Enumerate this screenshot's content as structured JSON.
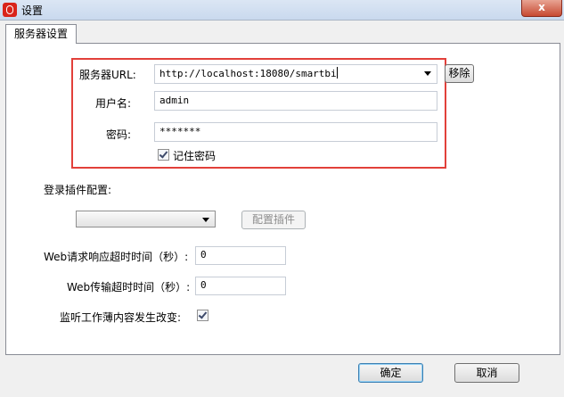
{
  "window": {
    "title": "设置",
    "close": "x"
  },
  "tabs": [
    {
      "label": "服务器设置"
    }
  ],
  "server": {
    "url_label": "服务器URL:",
    "url_value": "http://localhost:18080/smartbi",
    "remove_label": "移除",
    "username_label": "用户名:",
    "username_value": "admin",
    "password_label": "密码:",
    "password_value": "*******",
    "remember_label": "记住密码",
    "remember_checked": true
  },
  "plugin": {
    "label": "登录插件配置:",
    "selected": "",
    "config_button": "配置插件"
  },
  "timeouts": {
    "response_label": "Web请求响应超时时间（秒）:",
    "response_value": "0",
    "transfer_label": "Web传输超时时间（秒）:",
    "transfer_value": "0"
  },
  "monitor": {
    "label": "监听工作薄内容发生改变:",
    "checked": true
  },
  "footer": {
    "ok": "确定",
    "cancel": "取消"
  }
}
